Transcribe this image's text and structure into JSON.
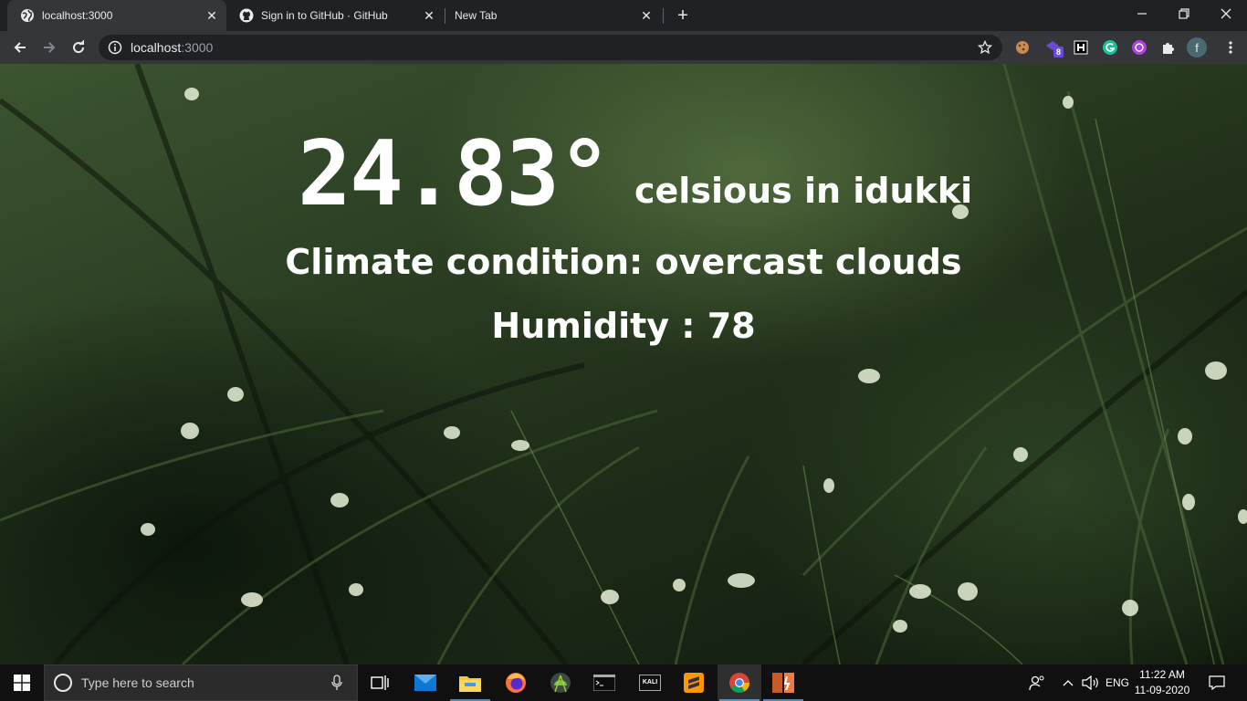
{
  "browser": {
    "tabs": [
      {
        "title": "localhost:3000",
        "favicon": "globe-icon",
        "active": true
      },
      {
        "title": "Sign in to GitHub · GitHub",
        "favicon": "github-icon",
        "active": false
      },
      {
        "title": "New Tab",
        "favicon": "",
        "active": false
      }
    ],
    "address": {
      "host": "localhost",
      "port": ":3000"
    },
    "extensions": [
      "cookie-icon",
      "extension-badge-icon",
      "honey-icon",
      "grammarly-icon",
      "color-picker-icon",
      "puzzle-icon",
      "profile-avatar"
    ],
    "extension_badge": "8",
    "profile_initial": "f"
  },
  "weather": {
    "temperature": "24.83°",
    "unit_city": "celsious in idukki",
    "condition": "Climate condition: overcast clouds",
    "humidity_label": "Humidity",
    "humidity_sep": " : ",
    "humidity_value": "78"
  },
  "taskbar": {
    "search_placeholder": "Type here to search",
    "apps": [
      "task-view-icon",
      "mail-icon",
      "file-explorer-icon",
      "firefox-icon",
      "android-studio-icon",
      "terminal-icon",
      "kali-icon",
      "sublime-text-icon",
      "chrome-icon",
      "git-client-icon"
    ],
    "kali_label": "KALI",
    "language": "ENG",
    "time": "11:22 AM",
    "date": "11-09-2020"
  },
  "colors": {
    "text": "#ffffff",
    "chrome_dark": "#202124",
    "chrome_toolbar": "#35363a",
    "taskbar": "#101010"
  }
}
